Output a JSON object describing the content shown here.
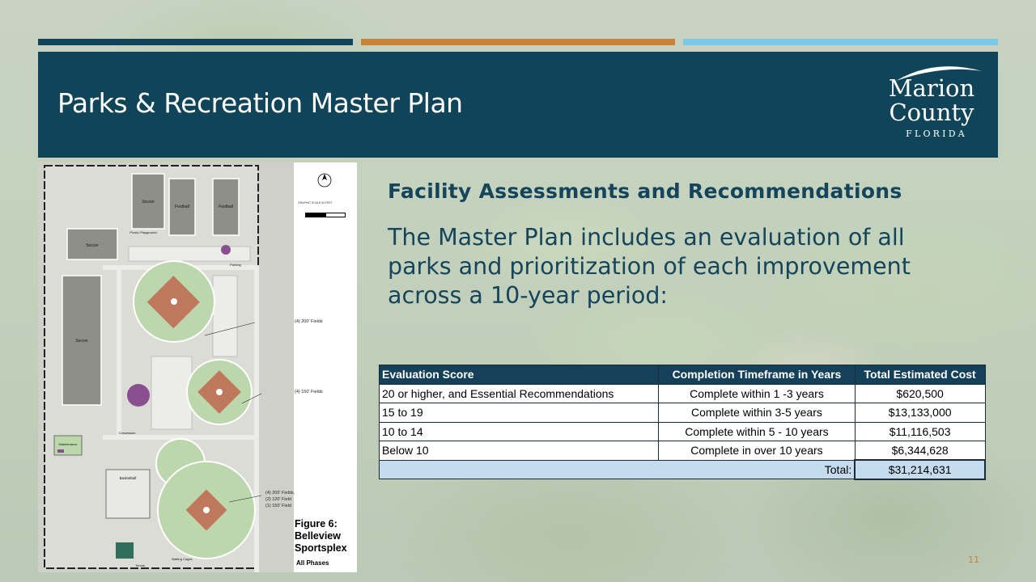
{
  "slide": {
    "title": "Parks & Recreation Master Plan",
    "page_number": "11",
    "colors": {
      "header_bg": "#0f4459",
      "stripe_navy": "#0f4459",
      "stripe_orange": "#c9823a",
      "stripe_light_blue": "#7cc8e8",
      "text_navy": "#14455a",
      "table_header_bg": "#14405a",
      "table_total_bg": "#c5dcee"
    }
  },
  "logo": {
    "line1": "Marion",
    "line2": "County",
    "line3": "FLORIDA"
  },
  "figure": {
    "caption_title": "Figure 6:",
    "caption_line2": "Belleview",
    "caption_line3": "Sportsplex",
    "caption_sub": "All Phases",
    "fields": {
      "soccer1": "Soccer",
      "football1": "Football",
      "football2": "Football",
      "soccer2": "Soccer",
      "soccer3": "Soccer",
      "picnic": "Picnic/ Playground",
      "parking": "Parking",
      "maintenance": "Maintenance",
      "basketball": "Basketball",
      "batting": "Batting Cages",
      "tennis": "Tennis",
      "concession": "Concession"
    },
    "callouts": {
      "c1": "(4) 200' Fields",
      "c2": "(4) 150' Fields",
      "c3a": "(4) 200' Fields,",
      "c3b": "(2) 120' Field",
      "c3c": "(1) 150' Field"
    },
    "scale_label": "GRAPHIC SCALE IN FEET",
    "north_label": "NORTH"
  },
  "content": {
    "heading": "Facility Assessments and Recommendations",
    "body_line1": "The Master Plan includes an evaluation of all",
    "body_line2": "parks and prioritization of each improvement",
    "body_line3": "across a 10-year period:"
  },
  "table": {
    "headers": [
      "Evaluation Score",
      "Completion Timeframe in Years",
      "Total Estimated Cost"
    ],
    "rows": [
      [
        "20 or higher, and Essential Recommendations",
        "Complete within 1 -3 years",
        "$620,500"
      ],
      [
        "15 to 19",
        "Complete within 3-5 years",
        "$13,133,000"
      ],
      [
        "10 to 14",
        "Complete within 5 - 10 years",
        "$11,116,503"
      ],
      [
        "Below 10",
        "Complete in over 10 years",
        "$6,344,628"
      ]
    ],
    "total_label": "Total:",
    "total_value": "$31,214,631"
  }
}
